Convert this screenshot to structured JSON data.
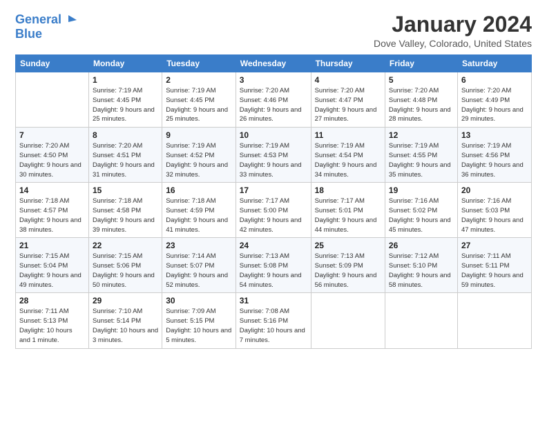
{
  "logo": {
    "line1": "General",
    "line2": "Blue"
  },
  "title": {
    "month_year": "January 2024",
    "location": "Dove Valley, Colorado, United States"
  },
  "weekdays": [
    "Sunday",
    "Monday",
    "Tuesday",
    "Wednesday",
    "Thursday",
    "Friday",
    "Saturday"
  ],
  "weeks": [
    [
      {
        "day": "",
        "sunrise": "",
        "sunset": "",
        "daylight": ""
      },
      {
        "day": "1",
        "sunrise": "Sunrise: 7:19 AM",
        "sunset": "Sunset: 4:45 PM",
        "daylight": "Daylight: 9 hours and 25 minutes."
      },
      {
        "day": "2",
        "sunrise": "Sunrise: 7:19 AM",
        "sunset": "Sunset: 4:45 PM",
        "daylight": "Daylight: 9 hours and 25 minutes."
      },
      {
        "day": "3",
        "sunrise": "Sunrise: 7:20 AM",
        "sunset": "Sunset: 4:46 PM",
        "daylight": "Daylight: 9 hours and 26 minutes."
      },
      {
        "day": "4",
        "sunrise": "Sunrise: 7:20 AM",
        "sunset": "Sunset: 4:47 PM",
        "daylight": "Daylight: 9 hours and 27 minutes."
      },
      {
        "day": "5",
        "sunrise": "Sunrise: 7:20 AM",
        "sunset": "Sunset: 4:48 PM",
        "daylight": "Daylight: 9 hours and 28 minutes."
      },
      {
        "day": "6",
        "sunrise": "Sunrise: 7:20 AM",
        "sunset": "Sunset: 4:49 PM",
        "daylight": "Daylight: 9 hours and 29 minutes."
      }
    ],
    [
      {
        "day": "7",
        "sunrise": "Sunrise: 7:20 AM",
        "sunset": "Sunset: 4:50 PM",
        "daylight": "Daylight: 9 hours and 30 minutes."
      },
      {
        "day": "8",
        "sunrise": "Sunrise: 7:20 AM",
        "sunset": "Sunset: 4:51 PM",
        "daylight": "Daylight: 9 hours and 31 minutes."
      },
      {
        "day": "9",
        "sunrise": "Sunrise: 7:19 AM",
        "sunset": "Sunset: 4:52 PM",
        "daylight": "Daylight: 9 hours and 32 minutes."
      },
      {
        "day": "10",
        "sunrise": "Sunrise: 7:19 AM",
        "sunset": "Sunset: 4:53 PM",
        "daylight": "Daylight: 9 hours and 33 minutes."
      },
      {
        "day": "11",
        "sunrise": "Sunrise: 7:19 AM",
        "sunset": "Sunset: 4:54 PM",
        "daylight": "Daylight: 9 hours and 34 minutes."
      },
      {
        "day": "12",
        "sunrise": "Sunrise: 7:19 AM",
        "sunset": "Sunset: 4:55 PM",
        "daylight": "Daylight: 9 hours and 35 minutes."
      },
      {
        "day": "13",
        "sunrise": "Sunrise: 7:19 AM",
        "sunset": "Sunset: 4:56 PM",
        "daylight": "Daylight: 9 hours and 36 minutes."
      }
    ],
    [
      {
        "day": "14",
        "sunrise": "Sunrise: 7:18 AM",
        "sunset": "Sunset: 4:57 PM",
        "daylight": "Daylight: 9 hours and 38 minutes."
      },
      {
        "day": "15",
        "sunrise": "Sunrise: 7:18 AM",
        "sunset": "Sunset: 4:58 PM",
        "daylight": "Daylight: 9 hours and 39 minutes."
      },
      {
        "day": "16",
        "sunrise": "Sunrise: 7:18 AM",
        "sunset": "Sunset: 4:59 PM",
        "daylight": "Daylight: 9 hours and 41 minutes."
      },
      {
        "day": "17",
        "sunrise": "Sunrise: 7:17 AM",
        "sunset": "Sunset: 5:00 PM",
        "daylight": "Daylight: 9 hours and 42 minutes."
      },
      {
        "day": "18",
        "sunrise": "Sunrise: 7:17 AM",
        "sunset": "Sunset: 5:01 PM",
        "daylight": "Daylight: 9 hours and 44 minutes."
      },
      {
        "day": "19",
        "sunrise": "Sunrise: 7:16 AM",
        "sunset": "Sunset: 5:02 PM",
        "daylight": "Daylight: 9 hours and 45 minutes."
      },
      {
        "day": "20",
        "sunrise": "Sunrise: 7:16 AM",
        "sunset": "Sunset: 5:03 PM",
        "daylight": "Daylight: 9 hours and 47 minutes."
      }
    ],
    [
      {
        "day": "21",
        "sunrise": "Sunrise: 7:15 AM",
        "sunset": "Sunset: 5:04 PM",
        "daylight": "Daylight: 9 hours and 49 minutes."
      },
      {
        "day": "22",
        "sunrise": "Sunrise: 7:15 AM",
        "sunset": "Sunset: 5:06 PM",
        "daylight": "Daylight: 9 hours and 50 minutes."
      },
      {
        "day": "23",
        "sunrise": "Sunrise: 7:14 AM",
        "sunset": "Sunset: 5:07 PM",
        "daylight": "Daylight: 9 hours and 52 minutes."
      },
      {
        "day": "24",
        "sunrise": "Sunrise: 7:13 AM",
        "sunset": "Sunset: 5:08 PM",
        "daylight": "Daylight: 9 hours and 54 minutes."
      },
      {
        "day": "25",
        "sunrise": "Sunrise: 7:13 AM",
        "sunset": "Sunset: 5:09 PM",
        "daylight": "Daylight: 9 hours and 56 minutes."
      },
      {
        "day": "26",
        "sunrise": "Sunrise: 7:12 AM",
        "sunset": "Sunset: 5:10 PM",
        "daylight": "Daylight: 9 hours and 58 minutes."
      },
      {
        "day": "27",
        "sunrise": "Sunrise: 7:11 AM",
        "sunset": "Sunset: 5:11 PM",
        "daylight": "Daylight: 9 hours and 59 minutes."
      }
    ],
    [
      {
        "day": "28",
        "sunrise": "Sunrise: 7:11 AM",
        "sunset": "Sunset: 5:13 PM",
        "daylight": "Daylight: 10 hours and 1 minute."
      },
      {
        "day": "29",
        "sunrise": "Sunrise: 7:10 AM",
        "sunset": "Sunset: 5:14 PM",
        "daylight": "Daylight: 10 hours and 3 minutes."
      },
      {
        "day": "30",
        "sunrise": "Sunrise: 7:09 AM",
        "sunset": "Sunset: 5:15 PM",
        "daylight": "Daylight: 10 hours and 5 minutes."
      },
      {
        "day": "31",
        "sunrise": "Sunrise: 7:08 AM",
        "sunset": "Sunset: 5:16 PM",
        "daylight": "Daylight: 10 hours and 7 minutes."
      },
      {
        "day": "",
        "sunrise": "",
        "sunset": "",
        "daylight": ""
      },
      {
        "day": "",
        "sunrise": "",
        "sunset": "",
        "daylight": ""
      },
      {
        "day": "",
        "sunrise": "",
        "sunset": "",
        "daylight": ""
      }
    ]
  ]
}
